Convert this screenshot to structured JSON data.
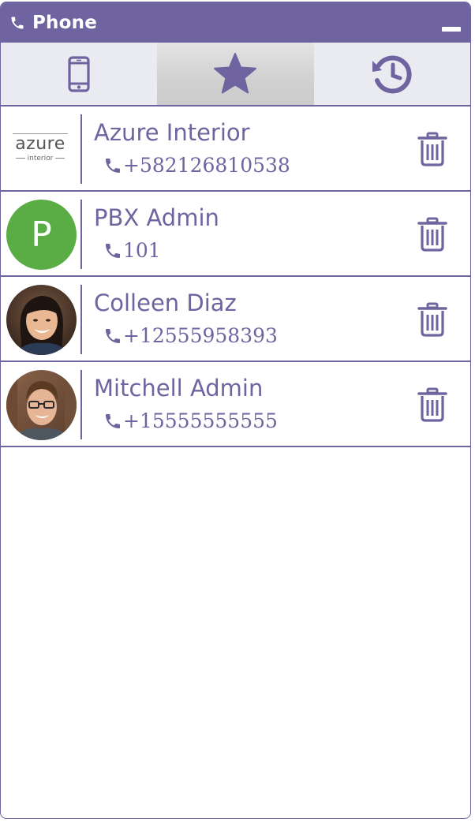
{
  "header": {
    "title": "Phone",
    "phone_icon": "phone-icon",
    "minimize_icon": "minimize-icon"
  },
  "tabs": [
    {
      "icon": "mobile-icon",
      "active": false
    },
    {
      "icon": "star-icon",
      "active": true
    },
    {
      "icon": "history-icon",
      "active": false
    }
  ],
  "contacts": [
    {
      "name": "Azure Interior",
      "phone": "+582126810538",
      "avatar": {
        "type": "logo",
        "text_main": "azure",
        "text_sub": "interior"
      }
    },
    {
      "name": "PBX Admin",
      "phone": "101",
      "avatar": {
        "type": "letter",
        "letter": "P",
        "color": "#5aad45"
      }
    },
    {
      "name": "Colleen Diaz",
      "phone": "+12555958393",
      "avatar": {
        "type": "photo",
        "icon": "woman-photo"
      }
    },
    {
      "name": "Mitchell Admin",
      "phone": "+15555555555",
      "avatar": {
        "type": "photo",
        "icon": "man-photo"
      }
    }
  ],
  "colors": {
    "accent": "#6f64a0",
    "tab_bar": "#e9ebf0",
    "active_tab": "#d0d0d0",
    "letter_avatar": "#5aad45"
  }
}
